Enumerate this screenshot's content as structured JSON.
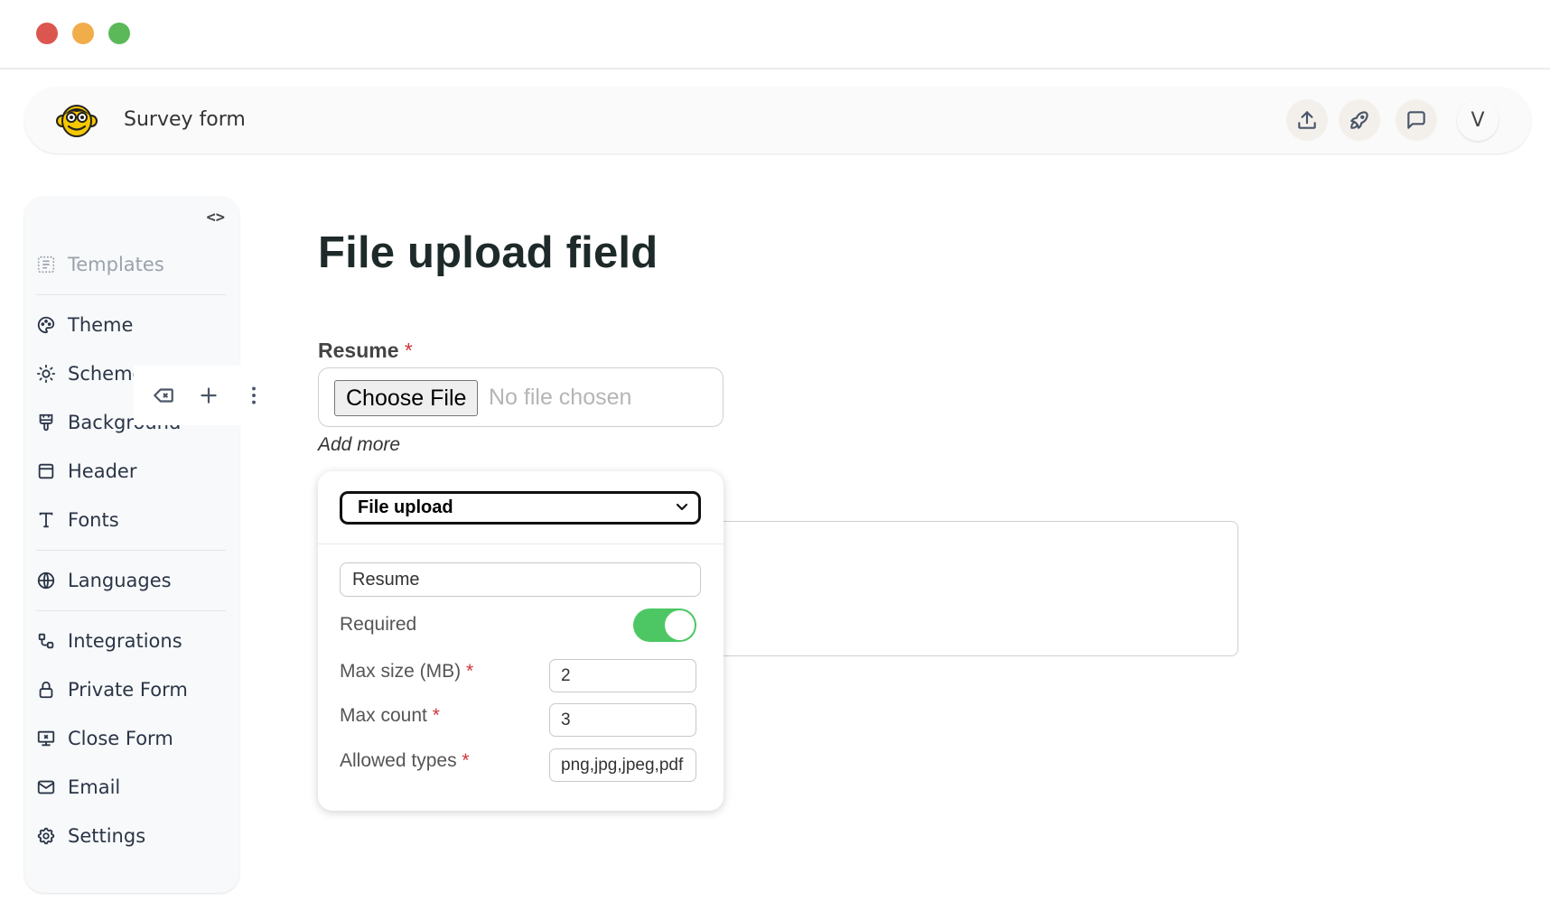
{
  "window": {
    "controls": [
      "close",
      "minimize",
      "maximize"
    ]
  },
  "header": {
    "app_title": "Survey form",
    "logo_icon": "monkey-face-icon",
    "actions": [
      {
        "name": "export",
        "icon": "upload-icon"
      },
      {
        "name": "publish",
        "icon": "rocket-icon"
      },
      {
        "name": "feedback",
        "icon": "chat-icon"
      }
    ],
    "avatar_initial": "V"
  },
  "sidebar": {
    "collapse_label": "<>",
    "items": [
      {
        "label": "Templates",
        "icon": "template-icon",
        "muted": true
      },
      {
        "label": "Theme",
        "icon": "palette-icon"
      },
      {
        "label": "Scheme",
        "icon": "sun-moon-icon"
      },
      {
        "label": "Background",
        "icon": "paint-brush-icon"
      },
      {
        "label": "Header",
        "icon": "header-layout-icon"
      },
      {
        "label": "Fonts",
        "icon": "typography-icon"
      },
      {
        "label": "Languages",
        "icon": "globe-icon"
      },
      {
        "label": "Integrations",
        "icon": "integrations-icon"
      },
      {
        "label": "Private Form",
        "icon": "lock-icon"
      },
      {
        "label": "Close Form",
        "icon": "close-form-icon"
      },
      {
        "label": "Email",
        "icon": "mail-icon"
      },
      {
        "label": "Settings",
        "icon": "gear-icon"
      }
    ]
  },
  "field_toolbar": {
    "tools": [
      {
        "name": "delete",
        "icon": "backspace-icon"
      },
      {
        "name": "add",
        "icon": "plus-icon"
      },
      {
        "name": "more",
        "icon": "more-vertical-icon"
      }
    ]
  },
  "main": {
    "title": "File upload field",
    "field": {
      "label": "Resume",
      "required_mark": "*",
      "choose_button": "Choose File",
      "status": "No file chosen",
      "add_more": "Add more"
    }
  },
  "field_settings": {
    "type_selected": "File upload",
    "label_value": "Resume",
    "required_label": "Required",
    "required_on": true,
    "max_size_label": "Max size (MB)",
    "max_size_value": "2",
    "max_count_label": "Max count",
    "max_count_value": "3",
    "allowed_types_label": "Allowed types",
    "allowed_types_value": "png,jpg,jpeg,pdf",
    "required_mark": "*"
  },
  "colors": {
    "toggle_on": "#4cc764",
    "required_mark": "#d0343a",
    "close_dot": "#dc5650",
    "minimize_dot": "#f0ad4a",
    "maximize_dot": "#5bb95a"
  }
}
